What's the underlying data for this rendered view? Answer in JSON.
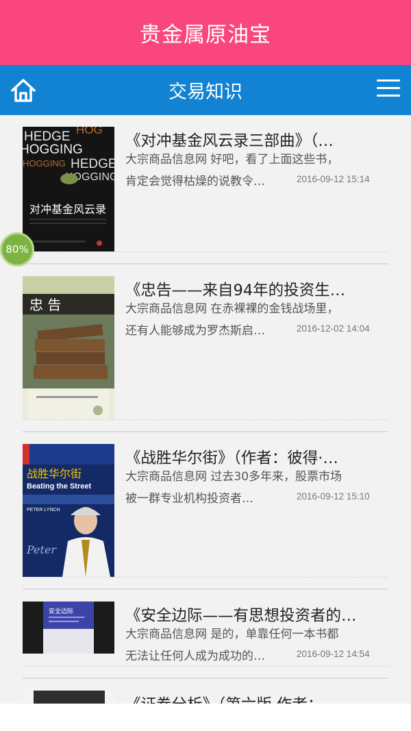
{
  "app": {
    "title": "贵金属原油宝"
  },
  "nav": {
    "title": "交易知识",
    "home_icon": "home-icon",
    "menu_icon": "hamburger-menu-icon"
  },
  "badge": {
    "text": "80%"
  },
  "colors": {
    "top_bar": "#f9467f",
    "nav_bar": "#1282d2",
    "badge": "#7cb342"
  },
  "articles": [
    {
      "title": "《对冲基金风云录三部曲》（…",
      "desc_line1": "大宗商品信息网 好吧，看了上面这些书，",
      "desc_line2": "肯定会觉得枯燥的说教令…",
      "date": "2016-09-12 15:14",
      "cover": {
        "lines": [
          "HEDGE",
          "HOGGING",
          "HEDGE",
          "HOGGING"
        ],
        "cn_title": "对冲基金风云录"
      }
    },
    {
      "title": "《忠告——来自94年的投资生…",
      "desc_line1": "大宗商品信息网 在赤裸裸的金钱战场里，",
      "desc_line2": "还有人能够成为罗杰斯启…",
      "date": "2016-12-02 14:04",
      "cover": {
        "cn_title": "忠 告"
      }
    },
    {
      "title": "《战胜华尔街》（作者：彼得·…",
      "desc_line1": "大宗商品信息网 过去30多年来，股票市场",
      "desc_line2": "被一群专业机构投资者…",
      "date": "2016-09-12 15:10",
      "cover": {
        "cn_title": "战胜华尔街",
        "en_title": "Beating the Street",
        "author": "PETER LYNCH"
      }
    },
    {
      "title": "《安全边际——有思想投资者的…",
      "desc_line1": "大宗商品信息网 是的，单靠任何一本书都",
      "desc_line2": "无法让任何人成为成功的…",
      "date": "2016-09-12 14:54",
      "cover": {
        "cn_title": "安全边际"
      }
    },
    {
      "title": "《证券分析》（第六版 作者：",
      "desc_line1": "",
      "desc_line2": "",
      "date": "",
      "cover": {}
    }
  ]
}
